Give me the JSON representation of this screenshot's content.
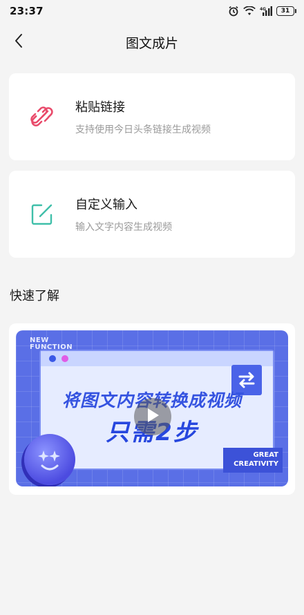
{
  "status_bar": {
    "time": "23:37",
    "battery": "31",
    "icons": [
      "alarm-icon",
      "wifi-icon",
      "signal-4g-icon",
      "battery-icon"
    ]
  },
  "nav": {
    "title": "图文成片",
    "back_icon": "chevron-left-icon"
  },
  "options": [
    {
      "title": "粘贴链接",
      "subtitle": "支持使用今日头条链接生成视频",
      "icon": "link-icon",
      "icon_color": "#e94b6b"
    },
    {
      "title": "自定义输入",
      "subtitle": "输入文字内容生成视频",
      "icon": "edit-icon",
      "icon_color": "#3fbfa9"
    }
  ],
  "quick_learn": {
    "title": "快速了解",
    "video": {
      "tag_line1": "NEW",
      "tag_line2": "FUNCTION",
      "headline": "将图文内容转换成视频",
      "subheadline": "只需2步",
      "badge_line1": "GREAT",
      "badge_line2": "CREATIVITY",
      "play_icon": "play-icon"
    }
  },
  "colors": {
    "background": "#f4f4f4",
    "card": "#ffffff",
    "video_blue": "#5a6fe6"
  }
}
